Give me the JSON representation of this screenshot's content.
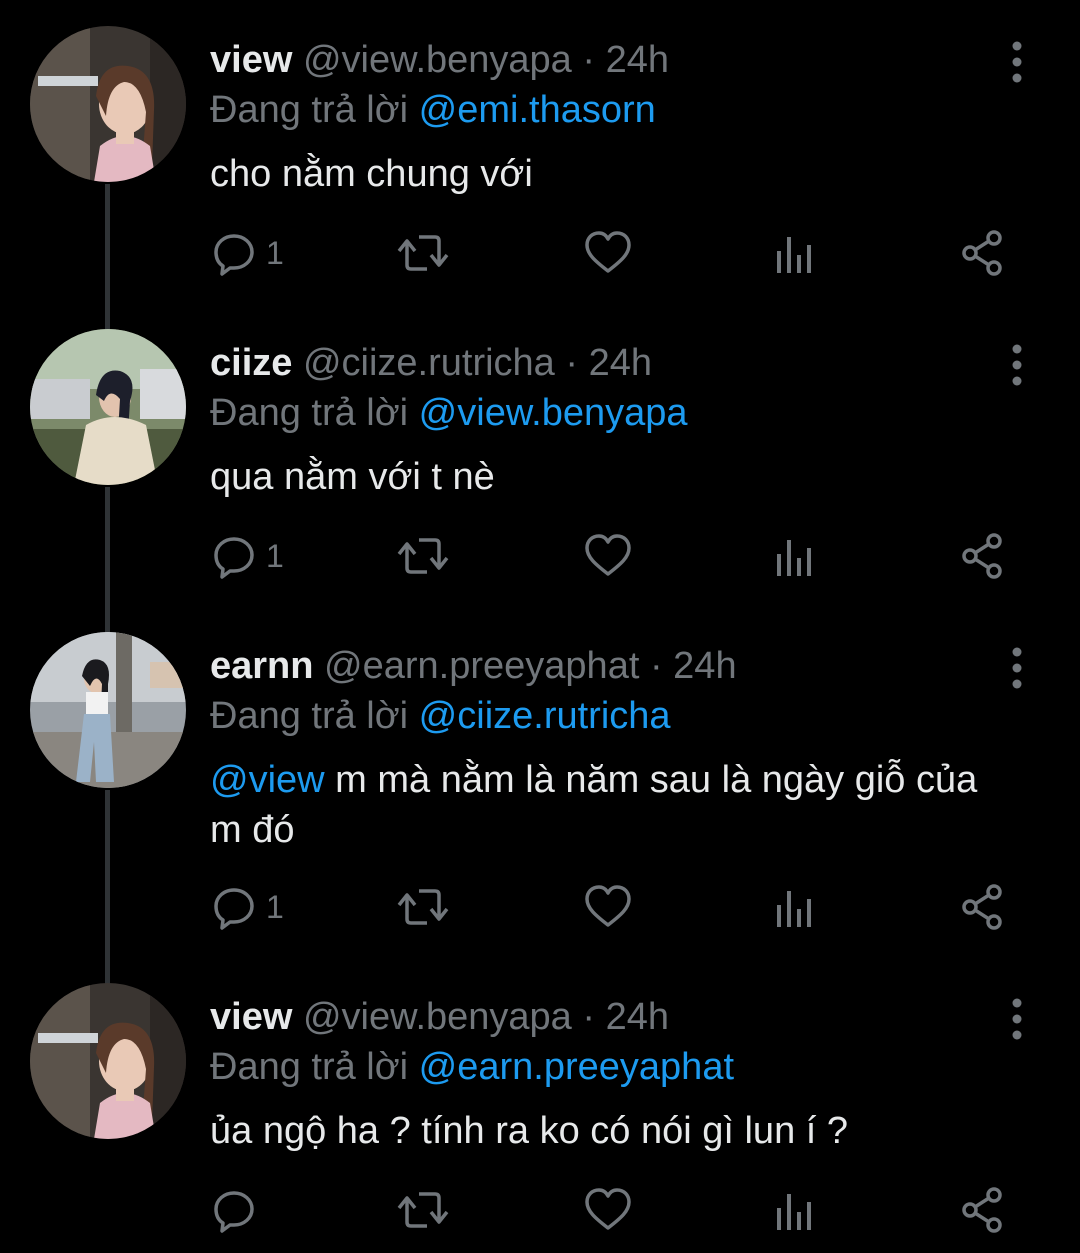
{
  "colors": {
    "background": "#000000",
    "text_primary": "#e7e9ea",
    "text_secondary": "#71767b",
    "accent": "#1d9bf0",
    "thread_line": "#2f3336"
  },
  "icons": {
    "reply": "comment-bubble-icon",
    "retweet": "retweet-icon",
    "like": "heart-icon",
    "views": "bar-chart-icon",
    "share": "share-icon",
    "more": "vertical-dots-icon"
  },
  "tweets": [
    {
      "display_name": "view",
      "handle": "@view.benyapa",
      "separator": "·",
      "time": "24h",
      "reply_prefix": "Đang trả lời",
      "reply_to": "@emi.thasorn",
      "mention": "",
      "text": "cho nằm chung với",
      "reply_count": "1"
    },
    {
      "display_name": "ciize",
      "handle": "@ciize.rutricha",
      "separator": "·",
      "time": "24h",
      "reply_prefix": "Đang trả lời",
      "reply_to": "@view.benyapa",
      "mention": "",
      "text": "qua nằm với t nè",
      "reply_count": "1"
    },
    {
      "display_name": "earnn",
      "handle": "@earn.preeyaphat",
      "separator": "·",
      "time": "24h",
      "reply_prefix": "Đang trả lời",
      "reply_to": "@ciize.rutricha",
      "mention": "@view",
      "text": " m mà nằm là năm sau là ngày giỗ của m đó",
      "reply_count": "1"
    },
    {
      "display_name": "view",
      "handle": "@view.benyapa",
      "separator": "·",
      "time": "24h",
      "reply_prefix": "Đang trả lời",
      "reply_to": "@earn.preeyaphat",
      "mention": "",
      "text": "ủa ngộ ha ? tính ra ko có nói gì lun í ?",
      "reply_count": ""
    }
  ]
}
